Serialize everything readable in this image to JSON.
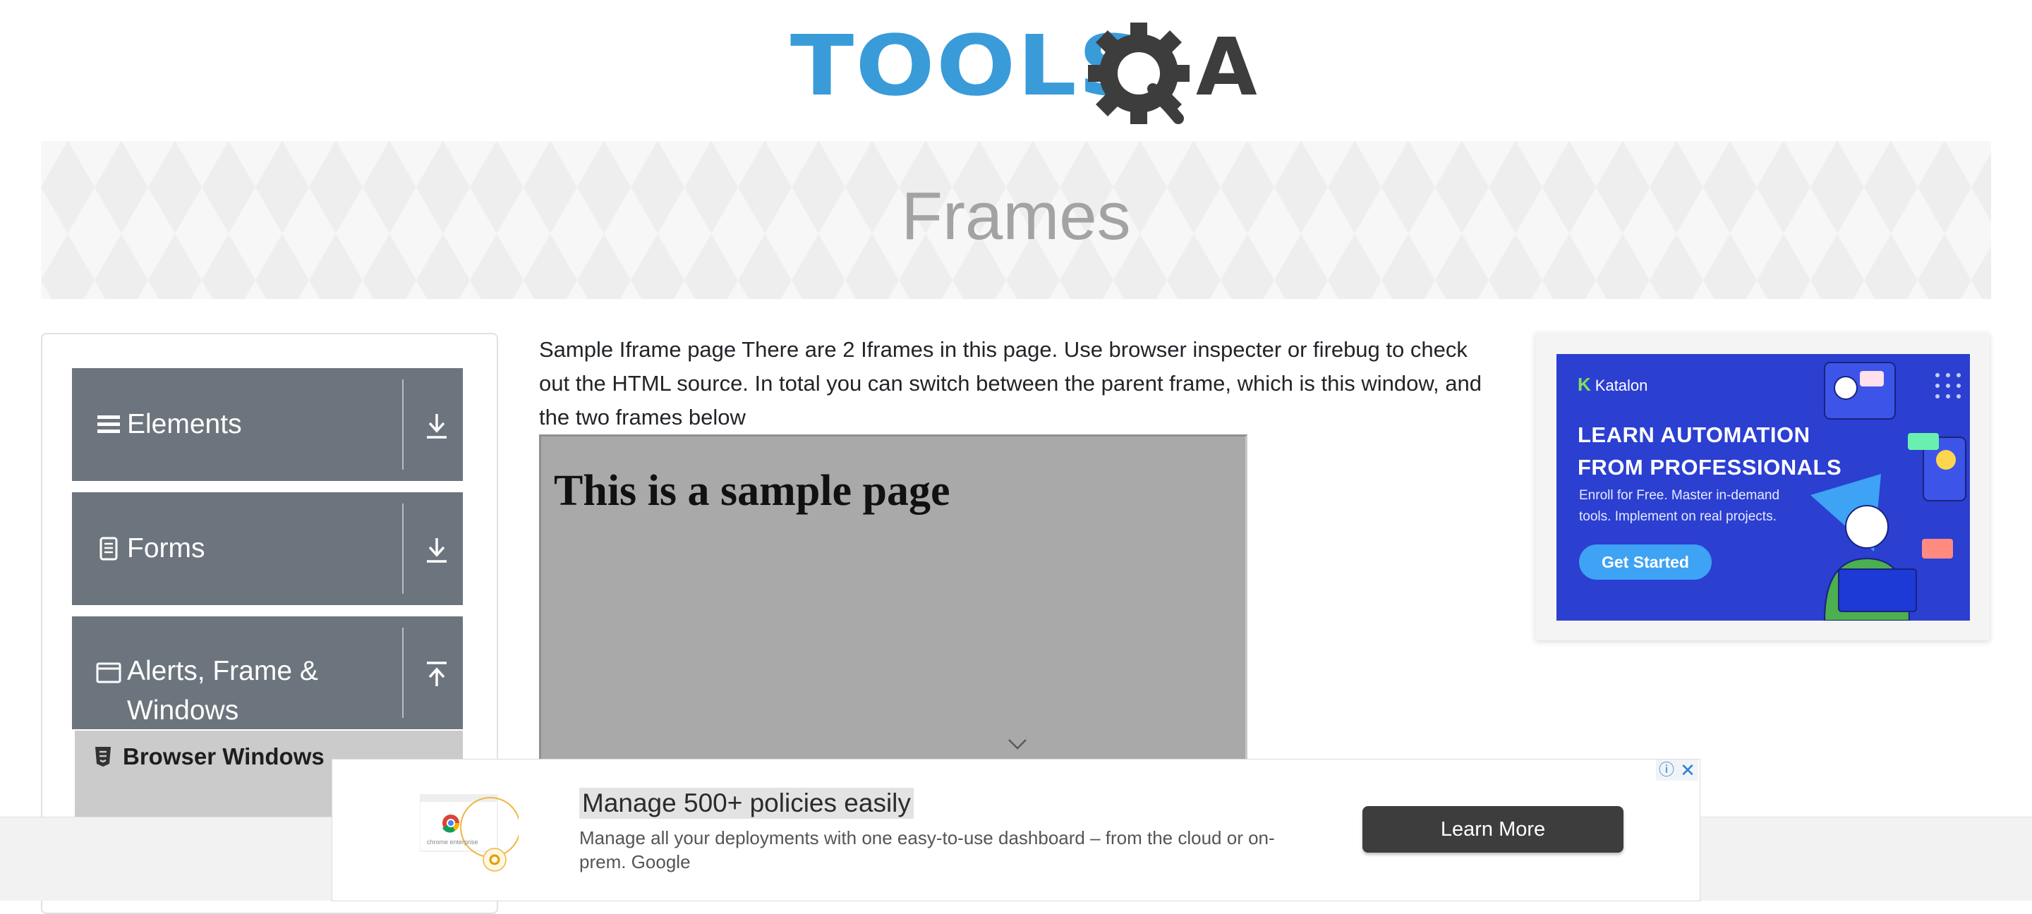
{
  "header": {
    "logo_text_primary": "TOOLS",
    "logo_text_secondary": "A",
    "brand_colors": {
      "tools": "#3a9bd9",
      "qa": "#3d3d3d"
    }
  },
  "banner": {
    "title": "Frames"
  },
  "sidebar": {
    "groups": [
      {
        "label": "Elements",
        "icon": "hamburger-icon",
        "toggle_icon": "download-arrow-icon"
      },
      {
        "label": "Forms",
        "icon": "document-icon",
        "toggle_icon": "download-arrow-icon"
      },
      {
        "label": "Alerts, Frame &",
        "label_line2": "Windows",
        "icon": "window-icon",
        "toggle_icon": "upload-arrow-icon"
      }
    ],
    "active_item": {
      "label": "Browser Windows",
      "icon": "html5-icon"
    },
    "colors": {
      "group_bg": "#6c757d",
      "item_bg": "#cbcbcb"
    }
  },
  "main": {
    "description": "Sample Iframe page There are 2 Iframes in this page. Use browser inspecter or firebug to check out the HTML source. In total you can switch between the parent frame, which is this window, and the two frames below",
    "frame1": {
      "heading": "This is a sample page",
      "bg": "#a9a9a9"
    }
  },
  "ad_right": {
    "brand": "Katalon",
    "title_line1": "LEARN AUTOMATION",
    "title_line2": "FROM PROFESSIONALS",
    "subtitle": "Enroll for Free. Master in-demand tools. Implement on real projects.",
    "cta": "Get Started",
    "bg": "#2b3fd1"
  },
  "ad_bottom": {
    "image_label": "chrome enterprise",
    "title": "Manage 500+ policies easily",
    "text": "Manage all your deployments with one easy-to-use dashboard – from the cloud or on-prem. Google",
    "button": "Learn More",
    "info_icon": "ⓘ",
    "close_icon": "✕"
  }
}
